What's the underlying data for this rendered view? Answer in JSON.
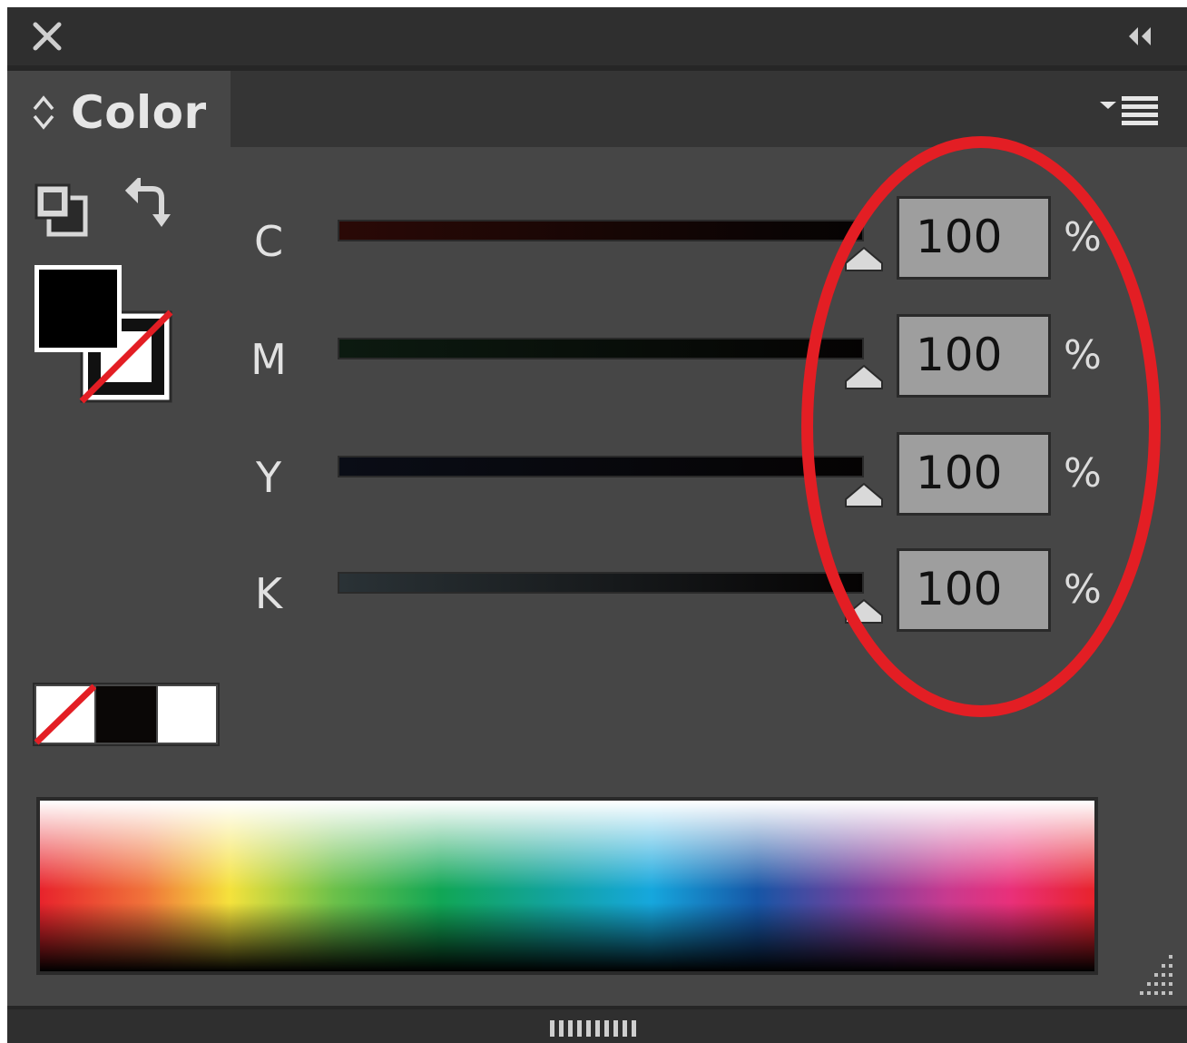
{
  "panel": {
    "tab_label": "Color"
  },
  "channels": [
    {
      "label": "C",
      "value": "100",
      "unit": "%",
      "level": 1.0
    },
    {
      "label": "M",
      "value": "100",
      "unit": "%",
      "level": 1.0
    },
    {
      "label": "Y",
      "value": "100",
      "unit": "%",
      "level": 1.0
    },
    {
      "label": "K",
      "value": "100",
      "unit": "%",
      "level": 1.0
    }
  ],
  "icons": {
    "close": "close-icon",
    "collapse": "double-chevron-left-icon",
    "tab_arrows": "up-down-arrows-icon",
    "menu": "panel-menu-icon",
    "formatting": "formatting-affects-container-icon",
    "swap": "swap-fill-stroke-icon",
    "resize": "resize-grip-icon",
    "drag": "drag-handle-icon"
  },
  "colors": {
    "panel_bg": "#464646",
    "annotation": "#e31e24",
    "fill": "#000000",
    "stroke_none_slash": "#e31e24"
  }
}
